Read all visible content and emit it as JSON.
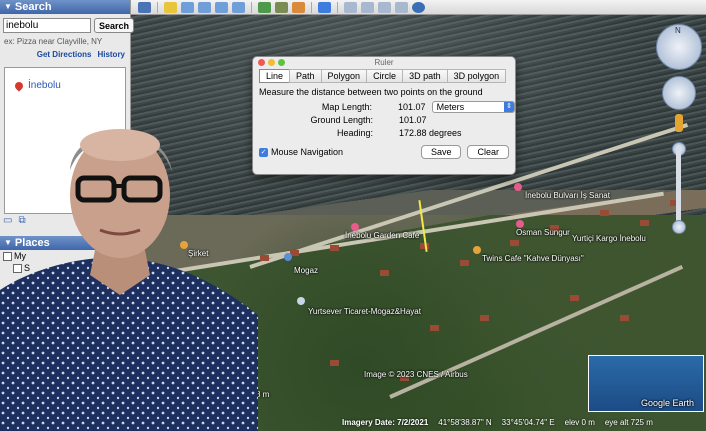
{
  "sidebar": {
    "search_title": "Search",
    "search_value": "inebolu",
    "search_button": "Search",
    "hint": "ex: Pizza near Clayville, NY",
    "get_directions": "Get Directions",
    "history": "History",
    "result": "İnebolu",
    "places_title": "Places",
    "places_items": [
      "My",
      "S"
    ]
  },
  "ruler": {
    "window_title": "Ruler",
    "tabs": [
      "Line",
      "Path",
      "Polygon",
      "Circle",
      "3D path",
      "3D polygon"
    ],
    "active_tab": "Line",
    "description": "Measure the distance between two points on the ground",
    "map_length_label": "Map Length:",
    "map_length_value": "101.07",
    "unit": "Meters",
    "ground_length_label": "Ground Length:",
    "ground_length_value": "101.07",
    "heading_label": "Heading:",
    "heading_value": "172.88 degrees",
    "mouse_navigation": "Mouse Navigation",
    "save": "Save",
    "clear": "Clear"
  },
  "map_labels": {
    "boulevard": "İnebolu Bulvarı İş Sanat",
    "garden": "İnebolu Garden Cafe",
    "osman": "Osman Sungur",
    "kargo": "Yurtiçi Kargo İnebolu",
    "mogaz": "Mogaz",
    "ticaret": "Yurtsever Ticaret-Mogaz&Hayat",
    "twins": "Twins Cafe \"Kahve Dünyası\"",
    "sirket": "Şirket",
    "eight_m": "8 m",
    "copyright": "Image © 2023 CNES / Airbus",
    "google_earth": "Google Earth"
  },
  "statusbar": {
    "imagery_date": "Imagery Date: 7/2/2021",
    "lat": "41°58'38.87\" N",
    "lon": "33°45'04.74\" E",
    "elev": "elev    0 m",
    "eye_alt": "eye alt   725 m"
  },
  "colors": {
    "accent": "#3d7de0",
    "sidebar_header": "#4a70b0"
  }
}
